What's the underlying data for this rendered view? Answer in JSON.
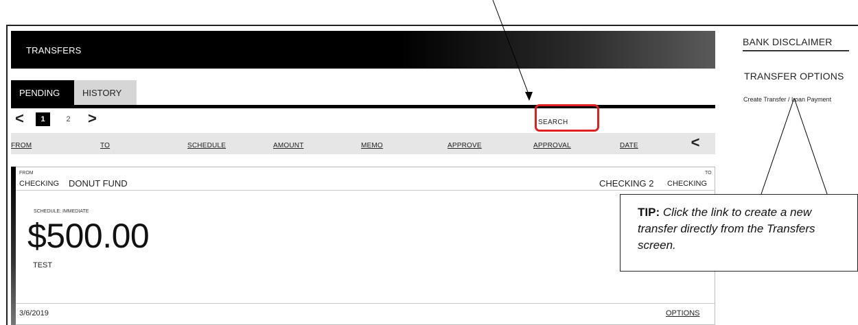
{
  "header": {
    "title": "TRANSFERS"
  },
  "tabs": [
    {
      "label": "PENDING"
    },
    {
      "label": "HISTORY"
    }
  ],
  "pager": {
    "prev": "<",
    "pages": [
      "1",
      "2"
    ],
    "next": ">"
  },
  "search": {
    "label": "SEARCH"
  },
  "columns": [
    "FROM",
    "TO",
    "SCHEDULE",
    "AMOUNT",
    "MEMO",
    "APPROVE",
    "APPROVAL",
    "DATE"
  ],
  "columns_toggle": "<",
  "transfer": {
    "from_caption": "FROM",
    "from_type": "CHECKING",
    "from_name": "DONUT FUND",
    "to_caption": "TO",
    "to_name": "CHECKING 2",
    "to_type": "CHECKING",
    "schedule": "SCHEDULE: IMMEDIATE",
    "amount": "$500.00",
    "memo": "TEST",
    "date": "3/6/2019",
    "options": "OPTIONS"
  },
  "sidebar": {
    "disclaimer": "BANK DISCLAIMER",
    "options_title": "TRANSFER OPTIONS",
    "link": "Create Transfer / Loan Payment"
  },
  "tip": {
    "label": "TIP:",
    "text": " Click the link to create a new transfer directly from the Transfers screen."
  },
  "colors": {
    "highlight": "#e02020",
    "header": "#000000",
    "tab_inactive": "#d6d6d6"
  }
}
